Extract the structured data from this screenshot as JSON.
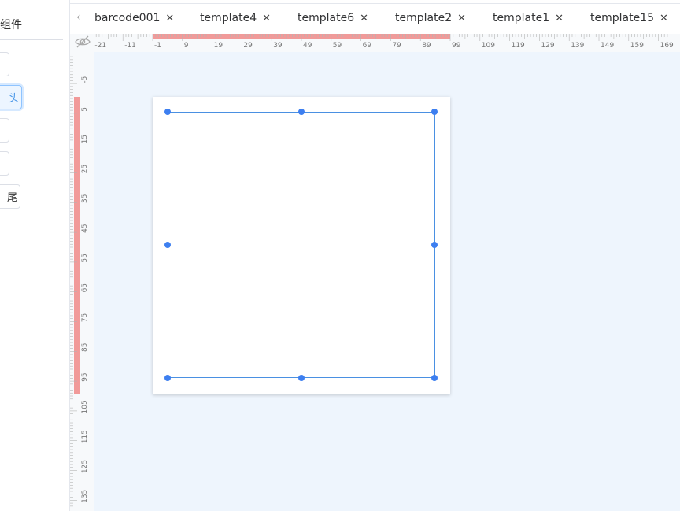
{
  "left_panel": {
    "title": "组件",
    "buttons": [
      {
        "label": ""
      },
      {
        "label": "头",
        "active": true
      },
      {
        "label": ""
      },
      {
        "label": ""
      },
      {
        "label": "尾"
      }
    ]
  },
  "tabs": [
    {
      "label": "barcode001"
    },
    {
      "label": "template4"
    },
    {
      "label": "template6"
    },
    {
      "label": "template2"
    },
    {
      "label": "template1"
    },
    {
      "label": "template15"
    }
  ],
  "ruler": {
    "horizontal_labels": [
      "-21",
      "-11",
      "-1",
      "9",
      "19",
      "29",
      "39",
      "49",
      "59",
      "69",
      "79",
      "89",
      "99",
      "109",
      "119",
      "129",
      "139",
      "149",
      "159",
      "169"
    ],
    "vertical_labels": [
      "-5",
      "5",
      "15",
      "25",
      "35",
      "45",
      "55",
      "65",
      "75",
      "85",
      "95",
      "105",
      "115",
      "125",
      "135"
    ],
    "highlight_color": "#f19a99",
    "hide_toggle_icon": "eye-slash-icon"
  },
  "colors": {
    "accent": "#3d7ff0",
    "selection": "#4a90e2",
    "canvas_bg": "#eef5fd"
  }
}
